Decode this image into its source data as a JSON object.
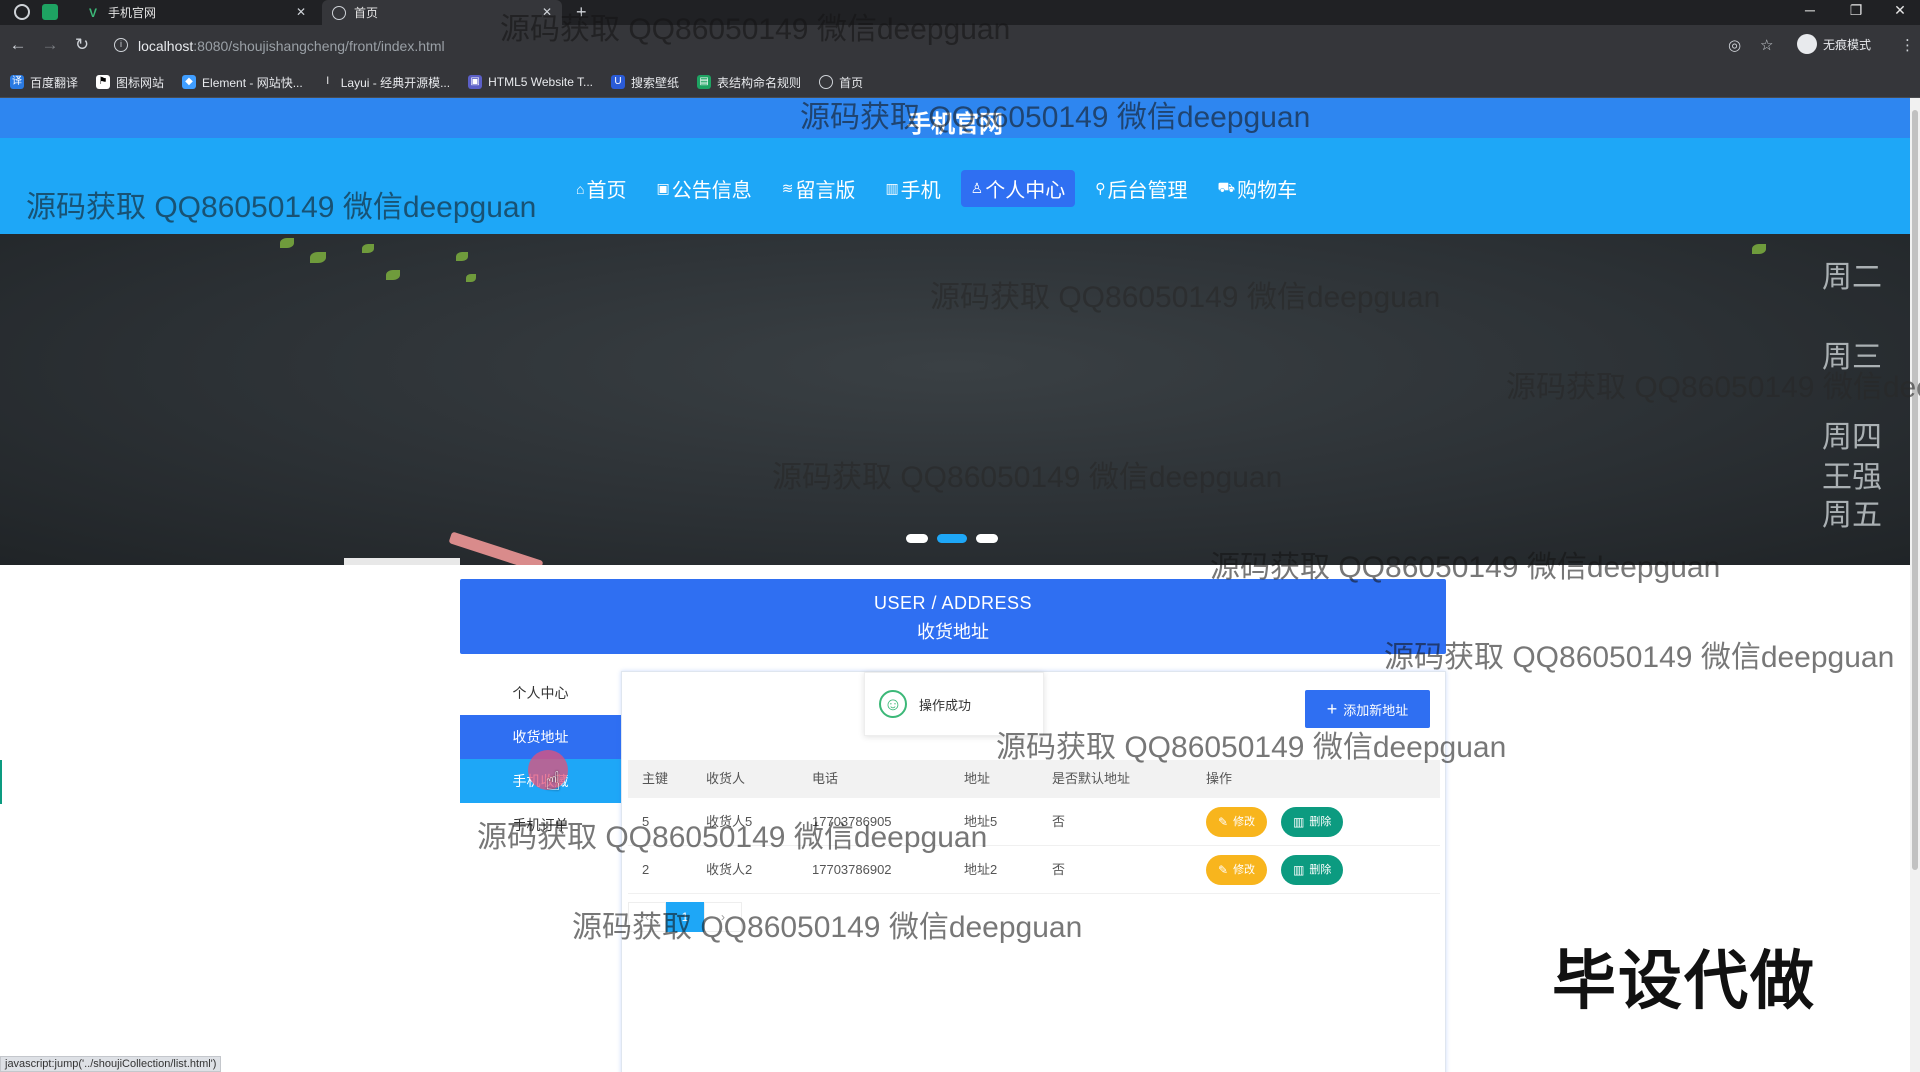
{
  "browser": {
    "tabs": [
      {
        "label": "手机官网",
        "active": false
      },
      {
        "label": "首页",
        "active": true
      }
    ],
    "url_host": "localhost",
    "url_rest": ":8080/shoujishangcheng/front/index.html",
    "profile_label": "无痕模式",
    "bookmarks": [
      "百度翻译",
      "图标网站",
      "Element - 网站快...",
      "Layui - 经典开源模...",
      "HTML5 Website T...",
      "搜索壁纸",
      "表结构命名规则",
      "首页"
    ],
    "status_url": "javascript:jump('../shoujiCollection/list.html')"
  },
  "site": {
    "title": "手机官网",
    "nav": [
      "首页",
      "公告信息",
      "留言版",
      "手机",
      "个人中心",
      "后台管理",
      "购物车"
    ],
    "nav_active_index": 4,
    "nav_icons": [
      "home-icon",
      "notice-icon",
      "message-icon",
      "phone-icon",
      "user-icon",
      "admin-icon",
      "cart-icon"
    ],
    "banner_chalk": [
      "周二",
      "周三",
      "周四",
      "王强",
      "周五"
    ],
    "carousel_active_index": 1,
    "carousel_count": 3
  },
  "breadcrumb": {
    "en": "USER / ADDRESS",
    "zh": "收货地址"
  },
  "sidebar": {
    "items": [
      {
        "label": "个人中心",
        "state": "normal"
      },
      {
        "label": "收货地址",
        "state": "active"
      },
      {
        "label": "手机收藏",
        "state": "hover"
      },
      {
        "label": "手机订单",
        "state": "normal"
      }
    ]
  },
  "toast": {
    "message": "操作成功"
  },
  "address": {
    "add_button": "添加新地址",
    "columns": [
      "主键",
      "收货人",
      "电话",
      "地址",
      "是否默认地址",
      "操作"
    ],
    "rows": [
      {
        "id": "5",
        "name": "收货人5",
        "phone": "17703786905",
        "address": "地址5",
        "is_default": "否"
      },
      {
        "id": "2",
        "name": "收货人2",
        "phone": "17703786902",
        "address": "地址2",
        "is_default": "否"
      }
    ],
    "edit_label": "修改",
    "delete_label": "删除",
    "pager": [
      "1"
    ]
  },
  "overlay": {
    "watermark": "源码获取 QQ86050149 微信deepguan",
    "corner_text": "毕设代做"
  },
  "colors": {
    "header_blue": "#2e86f0",
    "nav_cyan": "#1ea7f7",
    "accent_blue": "#2f6ff2",
    "edit_yellow": "#f8b51d",
    "delete_green": "#0c9b80"
  }
}
